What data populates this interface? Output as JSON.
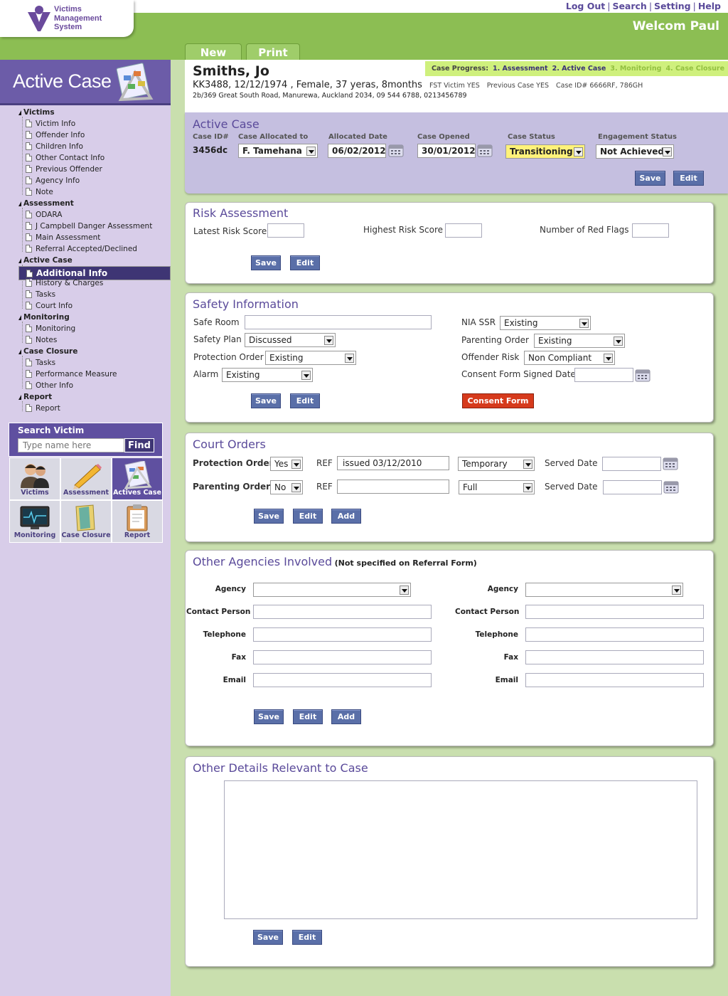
{
  "app": {
    "logo_lines": [
      "Victims",
      "Management",
      "System"
    ],
    "welcome": "Welcom Paul"
  },
  "toplinks": [
    "Log Out",
    "Search",
    "Setting",
    "Help"
  ],
  "tabs": {
    "new": "New",
    "print": "Print"
  },
  "sidebar": {
    "title": "Active Case",
    "sections": [
      {
        "label": "Victims",
        "items": [
          "Victim Info",
          "Offender Info",
          "Children Info",
          "Other Contact Info",
          "Previous Offender",
          "Agency Info",
          "Note"
        ]
      },
      {
        "label": "Assessment",
        "items": [
          "ODARA",
          "J Campbell Danger Assessment",
          "Main Assessment",
          "Referral Accepted/Declined"
        ]
      },
      {
        "label": "Active Case",
        "items": [
          "Additional Info",
          "History & Charges",
          "Tasks",
          "Court Info"
        ]
      },
      {
        "label": "Monitoring",
        "items": [
          "Monitoring",
          "Notes"
        ]
      },
      {
        "label": "Case Closure",
        "items": [
          "Tasks",
          "Performance Measure",
          "Other Info"
        ]
      },
      {
        "label": "Report",
        "items": [
          "Report"
        ]
      }
    ],
    "selected_item": "Additional Info",
    "search": {
      "label": "Search Victim",
      "placeholder": "Type name here",
      "button": "Find"
    },
    "tiles": [
      "Victims",
      "Assessment",
      "Actives Case",
      "Monitoring",
      "Case Closure",
      "Report"
    ]
  },
  "patient": {
    "name": "Smiths, Jo",
    "line1_main": "KK3488, 12/12/1974 , Female, 37 yeras, 8months",
    "line1_fst": "FST Victim YES",
    "line1_prev": "Previous Case YES",
    "line1_caseid": "Case ID# 6666RF, 786GH",
    "line2": "2b/369 Great South Road, Manurewa, Auckland 2034, 09 544 6788, 0213456789"
  },
  "progress": {
    "label": "Case Progress:",
    "steps": [
      {
        "label": "1. Assessment",
        "state": "done"
      },
      {
        "label": "2. Active Case",
        "state": "done"
      },
      {
        "label": "3. Monitoring",
        "state": "todo"
      },
      {
        "label": "4. Case Closure",
        "state": "todo"
      }
    ]
  },
  "active_case": {
    "title": "Active Case",
    "case_id_label": "Case ID#",
    "case_id": "3456dc",
    "allocated_to_label": "Case Allocated to",
    "allocated_to": "F. Tamehana",
    "allocated_date_label": "Allocated Date",
    "allocated_date": "06/02/2012",
    "case_opened_label": "Case Opened",
    "case_opened": "30/01/2012",
    "status_label": "Case Status",
    "status": "Transitioning",
    "engagement_label": "Engagement Status",
    "engagement": "Not Achieved",
    "save": "Save",
    "edit": "Edit"
  },
  "risk": {
    "title": "Risk Assessment",
    "latest": "Latest Risk Score",
    "highest": "Highest Risk Score",
    "flags": "Number of Red Flags",
    "save": "Save",
    "edit": "Edit"
  },
  "safety": {
    "title": "Safety Information",
    "safe_room": "Safe Room",
    "safety_plan": "Safety Plan",
    "safety_plan_value": "Discussed",
    "protection_order": "Protection Order",
    "protection_order_value": "Existing",
    "alarm": "Alarm",
    "alarm_value": "Existing",
    "nia_ssr": "NIA SSR",
    "nia_ssr_value": "Existing",
    "parenting_order": "Parenting Order",
    "parenting_order_value": "Existing",
    "offender_risk": "Offender Risk",
    "offender_risk_value": "Non Compliant",
    "consent_date": "Consent Form Signed Date",
    "save": "Save",
    "edit": "Edit",
    "consent_form": "Consent Form"
  },
  "court": {
    "title": "Court Orders",
    "rows": [
      {
        "label": "Protection Order",
        "yesno": "Yes",
        "ref_label": "REF",
        "ref": "issued 03/12/2010",
        "type": "Temporary",
        "served": "Served Date"
      },
      {
        "label": "Parenting Order",
        "yesno": "No",
        "ref_label": "REF",
        "ref": "",
        "type": "Full",
        "served": "Served Date"
      }
    ],
    "save": "Save",
    "edit": "Edit",
    "add": "Add"
  },
  "agencies": {
    "title": "Other Agencies Involved",
    "subtitle": "(Not specified on Referral Form)",
    "labels": [
      "Agency",
      "Contact Person",
      "Telephone",
      "Fax",
      "Email"
    ],
    "save": "Save",
    "edit": "Edit",
    "add": "Add"
  },
  "details": {
    "title": "Other Details Relevant to Case",
    "save": "Save",
    "edit": "Edit"
  },
  "colors": {
    "purple": "#6c5ca8",
    "green": "#8cbe53",
    "progress_bg": "#cff07d",
    "consent_red": "#d63a1c",
    "status_yellow": "#fff27a"
  }
}
